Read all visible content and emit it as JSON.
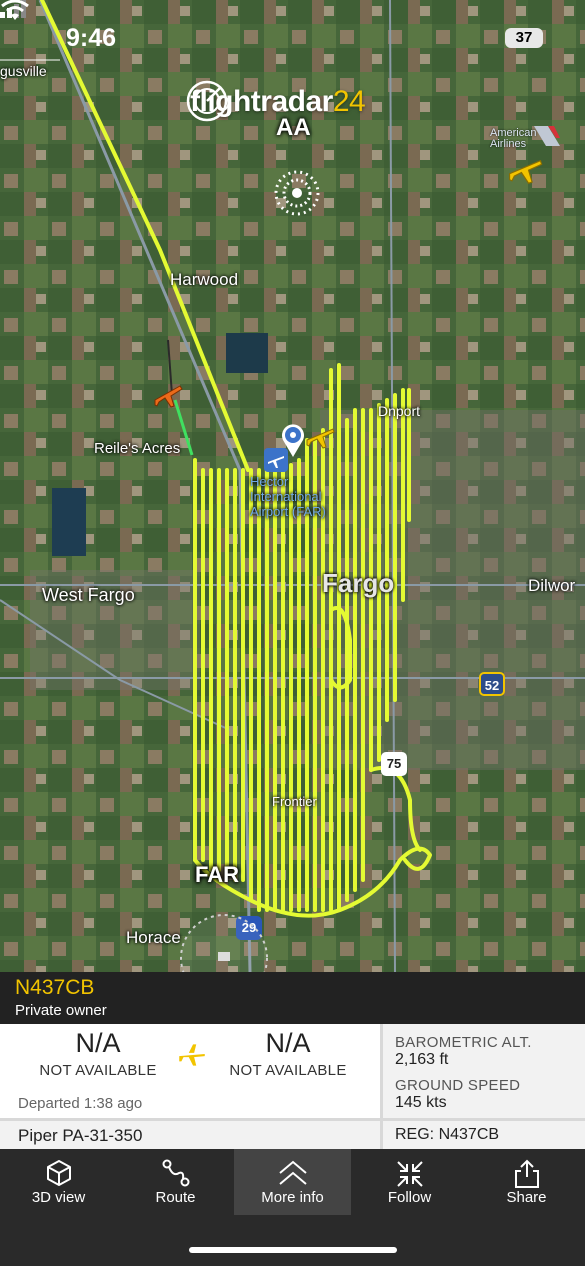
{
  "status_bar": {
    "time": "9:46",
    "battery": "37"
  },
  "brand": {
    "name": "flightradar",
    "suffix": "24"
  },
  "map": {
    "labels": {
      "ugusville": "gusville",
      "harwood": "Harwood",
      "reiles_acres": "Reile's Acres",
      "west_fargo": "West Fargo",
      "fargo": "Fargo",
      "dilworth": "Dilwor",
      "horace": "Horace",
      "frontier": "Frontier",
      "davenport": "Dnport",
      "airport_name": "Hector International Airport (FAR)",
      "aa_label": "AA",
      "far_label": "FAR",
      "american_airlines": "American Airlines"
    },
    "shields": {
      "route_52": "52",
      "route_75": "75",
      "route_29": "29"
    }
  },
  "flight": {
    "callsign": "N437CB",
    "owner": "Private owner",
    "origin_code": "N/A",
    "origin_sub": "NOT AVAILABLE",
    "dest_code": "N/A",
    "dest_sub": "NOT AVAILABLE",
    "departed": "Departed 1:38 ago",
    "baro_alt_label": "BAROMETRIC ALT.",
    "baro_alt_value": "2,163 ft",
    "ground_speed_label": "GROUND SPEED",
    "ground_speed_value": "145 kts",
    "aircraft_type": "Piper PA-31-350",
    "reg": "REG: N437CB"
  },
  "toolbar": {
    "view3d": "3D view",
    "route": "Route",
    "more_info": "More info",
    "follow": "Follow",
    "share": "Share"
  },
  "colors": {
    "track": "#e4fa33",
    "accent": "#f2c400",
    "brand_yellow": "#f2c400"
  }
}
